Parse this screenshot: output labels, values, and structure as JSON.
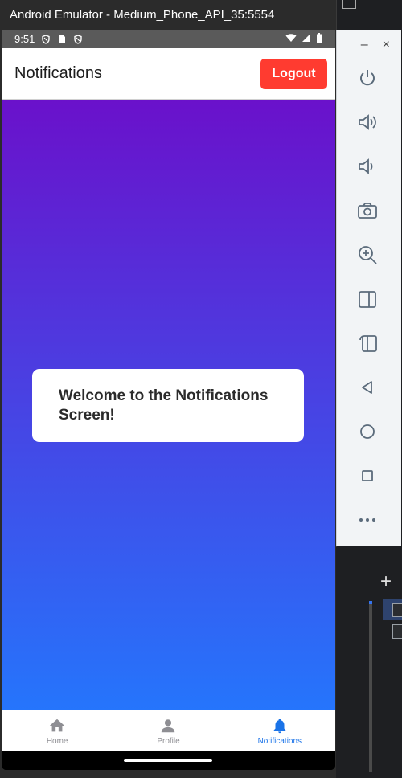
{
  "emulator": {
    "window_title": "Android Emulator - Medium_Phone_API_35:5554"
  },
  "status_bar": {
    "time": "9:51"
  },
  "app_bar": {
    "title": "Notifications",
    "logout_label": "Logout"
  },
  "main": {
    "welcome_message": "Welcome to the Notifications Screen!",
    "gradient_top": "#6a11cb",
    "gradient_bottom": "#2575fc"
  },
  "tab_bar": {
    "tabs": [
      {
        "label": "Home",
        "icon": "home-icon",
        "active": false
      },
      {
        "label": "Profile",
        "icon": "person-icon",
        "active": false
      },
      {
        "label": "Notifications",
        "icon": "bell-icon",
        "active": true
      }
    ],
    "active_color": "#1a73e8",
    "inactive_color": "#8e8e93"
  },
  "side_toolbar": {
    "minimize": "–",
    "close": "×",
    "buttons": [
      "power-icon",
      "volume-up-icon",
      "volume-down-icon",
      "camera-icon",
      "zoom-icon",
      "rotate-left-icon",
      "rotate-right-icon",
      "back-icon",
      "home-circle-icon",
      "overview-icon",
      "more-icon"
    ]
  },
  "colors": {
    "logout_button": "#ff3b30"
  }
}
